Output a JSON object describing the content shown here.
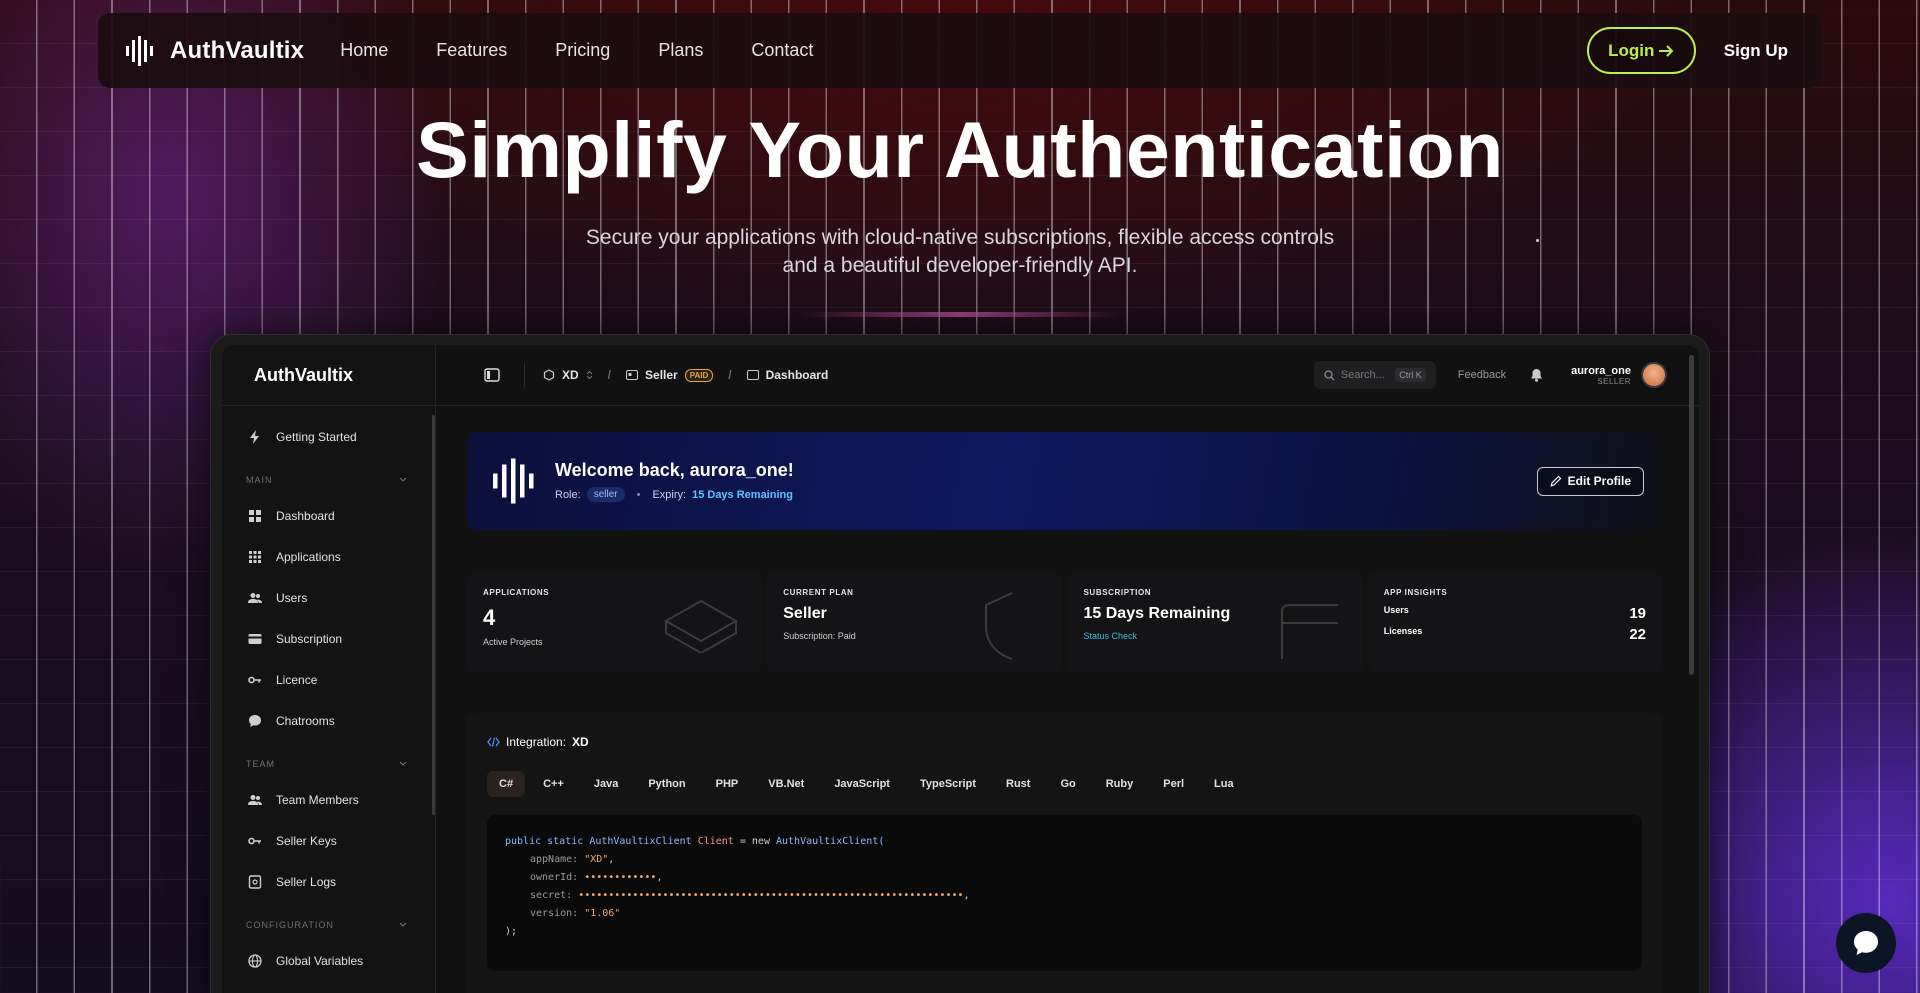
{
  "nav": {
    "brand": "AuthVaultix",
    "links": [
      "Home",
      "Features",
      "Pricing",
      "Plans",
      "Contact"
    ],
    "login": "Login",
    "signup": "Sign Up",
    "accent": "#b7f24a"
  },
  "hero": {
    "title": "Simplify Your Authentication",
    "subtitle_line1": "Secure your applications with cloud-native subscriptions, flexible access controls",
    "subtitle_line2": "and a beautiful developer-friendly API."
  },
  "dashboard": {
    "sidebar": {
      "logo": "AuthVaultix",
      "getting_started": "Getting Started",
      "sections": [
        {
          "title": "MAIN",
          "items": [
            {
              "label": "Dashboard",
              "icon": "grid-icon"
            },
            {
              "label": "Applications",
              "icon": "apps-icon"
            },
            {
              "label": "Users",
              "icon": "users-icon"
            },
            {
              "label": "Subscription",
              "icon": "card-icon"
            },
            {
              "label": "Licence",
              "icon": "key-icon"
            },
            {
              "label": "Chatrooms",
              "icon": "chat-icon"
            }
          ]
        },
        {
          "title": "TEAM",
          "items": [
            {
              "label": "Team Members",
              "icon": "users-icon"
            },
            {
              "label": "Seller Keys",
              "icon": "key-icon"
            },
            {
              "label": "Seller Logs",
              "icon": "log-icon"
            }
          ]
        },
        {
          "title": "CONFIGURATION",
          "items": [
            {
              "label": "Global Variables",
              "icon": "globe-icon"
            }
          ]
        }
      ]
    },
    "topbar": {
      "app": "XD",
      "seller": "Seller",
      "paid_badge": "PAID",
      "page": "Dashboard",
      "search_placeholder": "Search...",
      "search_shortcut": "Ctrl K",
      "feedback": "Feedback",
      "user_name": "aurora_one",
      "user_role": "SELLER"
    },
    "welcome": {
      "title": "Welcome back, aurora_one!",
      "role_label": "Role:",
      "role": "seller",
      "expiry_label": "Expiry:",
      "expiry": "15 Days Remaining",
      "edit_button": "Edit Profile"
    },
    "stats": {
      "applications": {
        "label": "APPLICATIONS",
        "value": "4",
        "sub": "Active Projects"
      },
      "plan": {
        "label": "CURRENT PLAN",
        "value": "Seller",
        "sub": "Subscription: Paid"
      },
      "subscription": {
        "label": "SUBSCRIPTION",
        "value": "15 Days Remaining",
        "link": "Status Check"
      },
      "insights": {
        "label": "APP INSIGHTS",
        "users_label": "Users",
        "users": "19",
        "licenses_label": "Licenses",
        "licenses": "22"
      }
    },
    "integration": {
      "label": "Integration:",
      "app": "XD",
      "tabs": [
        "C#",
        "C++",
        "Java",
        "Python",
        "PHP",
        "VB.Net",
        "JavaScript",
        "TypeScript",
        "Rust",
        "Go",
        "Ruby",
        "Perl",
        "Lua"
      ],
      "active_tab": "C#",
      "code": {
        "l1_kw": "public static",
        "l1_cls": "AuthVaultixClient",
        "l1_var": "Client",
        "l1_op": "= new",
        "l1_cls2": "AuthVaultixClient(",
        "appName_key": "appName:",
        "appName_val": "\"XD\"",
        "ownerId_key": "ownerId:",
        "ownerId_val": "••••••••••••",
        "secret_key": "secret:",
        "secret_val": "••••••••••••••••••••••••••••••••••••••••••••••••••••••••••••••••",
        "version_key": "version:",
        "version_val": "\"1.06\"",
        "close": ");"
      }
    }
  }
}
